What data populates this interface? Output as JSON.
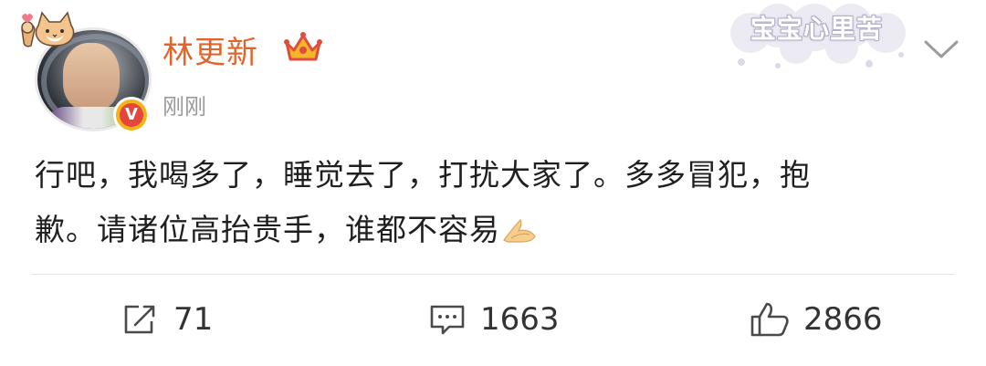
{
  "post": {
    "author": "林更新",
    "time": "刚刚",
    "decoration_text": "宝宝心里苦",
    "content_line1": "行吧，我喝多了，睡觉去了，打扰大家了。多多冒犯，抱",
    "content_line2": "歉。请诸位高抬贵手，谁都不容易"
  },
  "actions": {
    "share_count": "71",
    "comment_count": "1663",
    "like_count": "2866"
  },
  "icons": {
    "verified": "v-badge-icon",
    "vip": "crown-icon",
    "more": "chevron-down-icon",
    "share": "share-icon",
    "comment": "comment-icon",
    "like": "thumbs-up-icon",
    "emoji": "pray-hands-emoji"
  },
  "colors": {
    "username": "#e0652d",
    "time": "#9a9a9a",
    "badge_outer": "#f5b31a",
    "badge_inner": "#e4463b"
  }
}
